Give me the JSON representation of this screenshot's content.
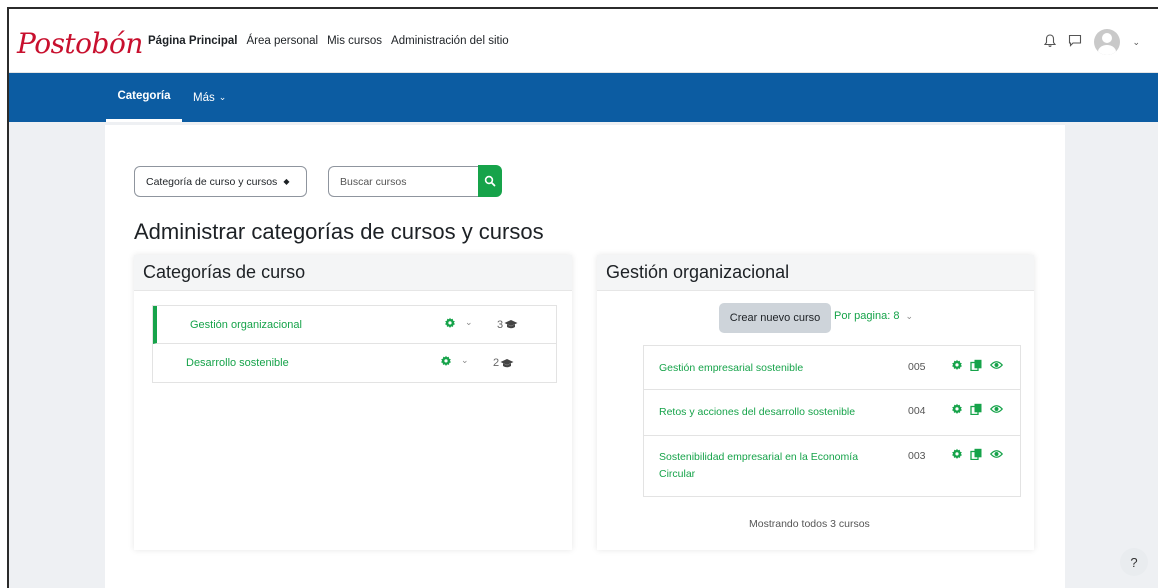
{
  "brand": {
    "logo_text": "Postobón",
    "accent": "#16a34a",
    "nav_color": "#0c5ca2",
    "logo_color": "#c8102e"
  },
  "primary_nav": [
    {
      "label": "Página Principal",
      "active": true
    },
    {
      "label": "Área personal"
    },
    {
      "label": "Mis cursos"
    },
    {
      "label": "Administración del sitio"
    }
  ],
  "top_icons": {
    "notifications": "bell-icon",
    "messages": "chat-icon",
    "user": "avatar"
  },
  "secondary_nav": {
    "category_label": "Categoría",
    "more_label": "Más"
  },
  "filters": {
    "select_value": "Categoría de curso y cursos",
    "search_placeholder": "Buscar cursos"
  },
  "page_title": "Administrar categorías de cursos y cursos",
  "left_panel": {
    "heading": "Categorías de curso",
    "categories": [
      {
        "name": "Gestión organizacional",
        "count": "3",
        "selected": true
      },
      {
        "name": "Desarrollo sostenible",
        "count": "2"
      }
    ]
  },
  "right_panel": {
    "heading": "Gestión organizacional",
    "create_button": "Crear nuevo curso",
    "per_page": "Por pagina: 8",
    "courses": [
      {
        "name": "Gestión empresarial sostenible",
        "id": "005"
      },
      {
        "name": "Retos y acciones del desarrollo sostenible",
        "id": "004"
      },
      {
        "name": "Sostenibilidad empresarial en la Economía Circular",
        "id": "003"
      }
    ],
    "showing": "Mostrando todos 3 cursos"
  },
  "help_label": "?"
}
